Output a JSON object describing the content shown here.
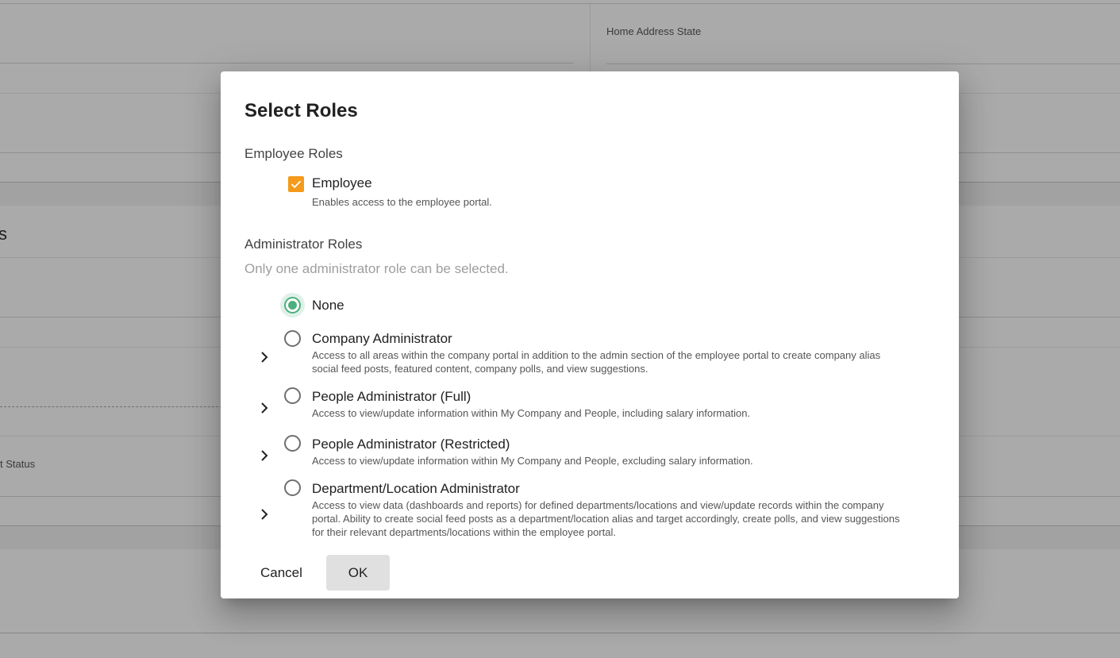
{
  "background": {
    "field_label_home_state": "Home Address State",
    "section_heading_partial": "s",
    "field_label_status_partial": "t Status"
  },
  "dialog": {
    "title": "Select Roles",
    "employee_section": {
      "title": "Employee Roles",
      "role": {
        "label": "Employee",
        "description": "Enables access to the employee portal.",
        "checked": true
      }
    },
    "admin_section": {
      "title": "Administrator Roles",
      "hint": "Only one administrator role can be selected.",
      "selected": "None",
      "roles": [
        {
          "label": "None",
          "description": ""
        },
        {
          "label": "Company Administrator",
          "description": "Access to all areas within the company portal in addition to the admin section of the employee portal to create company alias social feed posts, featured content, company polls, and view suggestions."
        },
        {
          "label": "People Administrator (Full)",
          "description": "Access to view/update information within My Company and People, including salary information."
        },
        {
          "label": "People Administrator (Restricted)",
          "description": "Access to view/update information within My Company and People, excluding salary information."
        },
        {
          "label": "Department/Location Administrator",
          "description": "Access to view data (dashboards and reports) for defined departments/locations and view/update records within the company portal. Ability to create social feed posts as a department/location alias and target accordingly, create polls, and view suggestions for their relevant departments/locations within the employee portal."
        }
      ]
    },
    "buttons": {
      "cancel": "Cancel",
      "ok": "OK"
    }
  },
  "colors": {
    "checkbox_accent": "#f59a1b",
    "radio_selected": "#4caf7d",
    "ok_button_bg": "#e0e0e0"
  },
  "icons": [
    "check-icon",
    "chevron-right-icon"
  ]
}
